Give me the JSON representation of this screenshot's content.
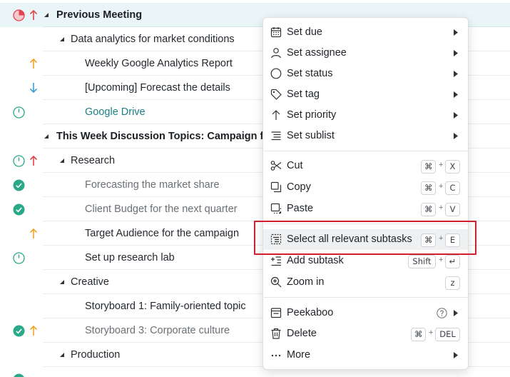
{
  "tasks": [
    {
      "label": "Previous Meeting",
      "style": "bold"
    },
    {
      "label": "Data analytics for market conditions",
      "style": "normal"
    },
    {
      "label": "Weekly Google Analytics Report",
      "style": "normal"
    },
    {
      "label": "[Upcoming] Forecast the details",
      "style": "normal"
    },
    {
      "label": "Google Drive",
      "style": "link"
    },
    {
      "label": "This Week Discussion Topics: Campaign fo",
      "style": "bold"
    },
    {
      "label": "Research",
      "style": "normal"
    },
    {
      "label": "Forecasting the market share",
      "style": "muted"
    },
    {
      "label": "Client Budget for the next quarter",
      "style": "muted"
    },
    {
      "label": "Target Audience for the campaign",
      "style": "normal"
    },
    {
      "label": "Set up research lab",
      "style": "normal"
    },
    {
      "label": "Creative",
      "style": "normal"
    },
    {
      "label": "Storyboard 1: Family-oriented topic",
      "style": "normal"
    },
    {
      "label": "Storyboard 3: Corporate culture",
      "style": "muted"
    },
    {
      "label": "Production",
      "style": "normal"
    }
  ],
  "menu": {
    "set_due": "Set due",
    "set_assignee": "Set assignee",
    "set_status": "Set status",
    "set_tag": "Set tag",
    "set_priority": "Set priority",
    "set_sublist": "Set sublist",
    "cut": "Cut",
    "copy": "Copy",
    "paste": "Paste",
    "select_subtasks": "Select all relevant subtasks",
    "add_subtask": "Add subtask",
    "zoom_in": "Zoom in",
    "peekaboo": "Peekaboo",
    "delete": "Delete",
    "more": "More"
  },
  "shortcuts": {
    "cmd": "⌘",
    "plus": "+",
    "cut_key": "X",
    "copy_key": "C",
    "paste_key": "V",
    "select_key": "E",
    "shift": "Shift",
    "enter": "↵",
    "zoom_key": "z",
    "del_key": "DEL"
  },
  "colors": {
    "green": "#2aa889",
    "red": "#e0454f",
    "orange": "#f0a32a",
    "blue": "#3a9fd4",
    "highlight_box": "#d11f2f"
  }
}
